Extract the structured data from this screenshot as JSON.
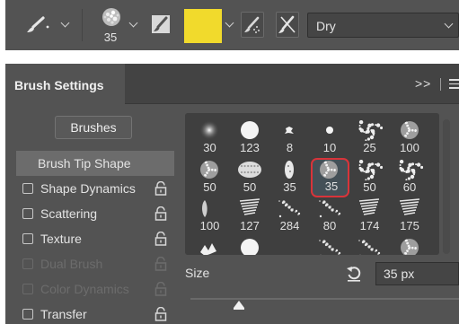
{
  "options_bar": {
    "brush_tool_icon": "paintbrush-icon",
    "brush_size": "35",
    "mode_icon": "brush-settings-toggle-icon",
    "foreground_color": "#f1da2c",
    "airbrush_icon": "airbrush-icon",
    "sample_all_icon": "sample-all-layers-icon",
    "blend_mode": "Dry"
  },
  "panel": {
    "title": "Brush Settings",
    "menu_label": ">>",
    "brushes_button": "Brushes",
    "sidebar": [
      {
        "label": "Brush Tip Shape",
        "selected": true,
        "checkbox": false,
        "lock": false,
        "enabled": true
      },
      {
        "label": "Shape Dynamics",
        "selected": false,
        "checkbox": true,
        "lock": true,
        "enabled": true
      },
      {
        "label": "Scattering",
        "selected": false,
        "checkbox": true,
        "lock": true,
        "enabled": true
      },
      {
        "label": "Texture",
        "selected": false,
        "checkbox": true,
        "lock": true,
        "enabled": true
      },
      {
        "label": "Dual Brush",
        "selected": false,
        "checkbox": true,
        "lock": true,
        "enabled": false
      },
      {
        "label": "Color Dynamics",
        "selected": false,
        "checkbox": true,
        "lock": true,
        "enabled": false
      },
      {
        "label": "Transfer",
        "selected": false,
        "checkbox": true,
        "lock": true,
        "enabled": true
      }
    ],
    "brush_presets": [
      {
        "size": "30",
        "shape": "soft"
      },
      {
        "size": "123",
        "shape": "hard"
      },
      {
        "size": "8",
        "shape": "splat"
      },
      {
        "size": "10",
        "shape": "dot"
      },
      {
        "size": "25",
        "shape": "spatter"
      },
      {
        "size": "100",
        "shape": "speckle"
      },
      {
        "size": "50",
        "shape": "speckle"
      },
      {
        "size": "50",
        "shape": "sponge"
      },
      {
        "size": "35",
        "shape": "grain"
      },
      {
        "size": "35",
        "shape": "speckle",
        "selected": true
      },
      {
        "size": "50",
        "shape": "spatter"
      },
      {
        "size": "60",
        "shape": "spatter"
      },
      {
        "size": "100",
        "shape": "chalk"
      },
      {
        "size": "127",
        "shape": "streak"
      },
      {
        "size": "284",
        "shape": "dots"
      },
      {
        "size": "80",
        "shape": "dots"
      },
      {
        "size": "174",
        "shape": "streak"
      },
      {
        "size": "175",
        "shape": "streak"
      },
      {
        "size": "",
        "shape": "leaf"
      },
      {
        "size": "",
        "shape": "hard"
      },
      {
        "size": "",
        "shape": "none"
      },
      {
        "size": "",
        "shape": "dots"
      },
      {
        "size": "",
        "shape": "dots"
      },
      {
        "size": "",
        "shape": "speckle"
      }
    ],
    "size_label": "Size",
    "size_value": "35 px",
    "size_slider_fraction": 0.18,
    "reset_icon": "reset-size-icon"
  }
}
